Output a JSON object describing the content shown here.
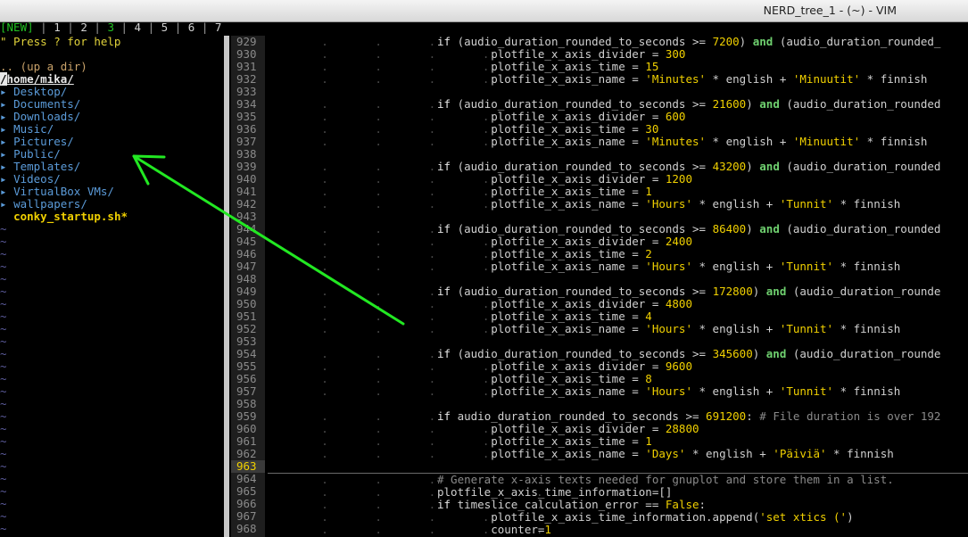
{
  "window": {
    "title": "NERD_tree_1 - (~) - VIM"
  },
  "tabline": {
    "tabs": [
      {
        "label": "[NEW]"
      },
      {
        "label": "1"
      },
      {
        "label": "2"
      },
      {
        "label": "3"
      },
      {
        "label": "4"
      },
      {
        "label": "5"
      },
      {
        "label": "6"
      },
      {
        "label": "7"
      }
    ],
    "active_index": 3
  },
  "tree": {
    "help": "\" Press ? for help",
    "updir": ".. (up a dir)",
    "root_cursor": "/",
    "root_rest": "home/mika/",
    "dirs": [
      "Desktop/",
      "Documents/",
      "Downloads/",
      "Music/",
      "Pictures/",
      "Public/",
      "Templates/",
      "Videos/",
      "VirtualBox VMs/",
      "wallpapers/"
    ],
    "file": "conky_startup.sh*",
    "dir_arrow": "▸",
    "tilde": "~"
  },
  "editor": {
    "current_line": "963",
    "lines": [
      {
        "n": "929",
        "t": "if (audio_duration_rounded_to_seconds >= 7200) and (audio_duration_rounded_"
      },
      {
        "n": "930",
        "t": "        plotfile_x_axis_divider = 300"
      },
      {
        "n": "931",
        "t": "        plotfile_x_axis_time = 15"
      },
      {
        "n": "932",
        "t": "        plotfile_x_axis_name = 'Minutes' * english + 'Minuutit' * finnish"
      },
      {
        "n": "933",
        "t": ""
      },
      {
        "n": "934",
        "t": "if (audio_duration_rounded_to_seconds >= 21600) and (audio_duration_rounded"
      },
      {
        "n": "935",
        "t": "        plotfile_x_axis_divider = 600"
      },
      {
        "n": "936",
        "t": "        plotfile_x_axis_time = 30"
      },
      {
        "n": "937",
        "t": "        plotfile_x_axis_name = 'Minutes' * english + 'Minuutit' * finnish"
      },
      {
        "n": "938",
        "t": ""
      },
      {
        "n": "939",
        "t": "if (audio_duration_rounded_to_seconds >= 43200) and (audio_duration_rounded"
      },
      {
        "n": "940",
        "t": "        plotfile_x_axis_divider = 1200"
      },
      {
        "n": "941",
        "t": "        plotfile_x_axis_time = 1"
      },
      {
        "n": "942",
        "t": "        plotfile_x_axis_name = 'Hours' * english + 'Tunnit' * finnish"
      },
      {
        "n": "943",
        "t": ""
      },
      {
        "n": "944",
        "t": "if (audio_duration_rounded_to_seconds >= 86400) and (audio_duration_rounded"
      },
      {
        "n": "945",
        "t": "        plotfile_x_axis_divider = 2400"
      },
      {
        "n": "946",
        "t": "        plotfile_x_axis_time = 2"
      },
      {
        "n": "947",
        "t": "        plotfile_x_axis_name = 'Hours' * english + 'Tunnit' * finnish"
      },
      {
        "n": "948",
        "t": ""
      },
      {
        "n": "949",
        "t": "if (audio_duration_rounded_to_seconds >= 172800) and (audio_duration_rounde"
      },
      {
        "n": "950",
        "t": "        plotfile_x_axis_divider = 4800"
      },
      {
        "n": "951",
        "t": "        plotfile_x_axis_time = 4"
      },
      {
        "n": "952",
        "t": "        plotfile_x_axis_name = 'Hours' * english + 'Tunnit' * finnish"
      },
      {
        "n": "953",
        "t": ""
      },
      {
        "n": "954",
        "t": "if (audio_duration_rounded_to_seconds >= 345600) and (audio_duration_rounde"
      },
      {
        "n": "955",
        "t": "        plotfile_x_axis_divider = 9600"
      },
      {
        "n": "956",
        "t": "        plotfile_x_axis_time = 8"
      },
      {
        "n": "957",
        "t": "        plotfile_x_axis_name = 'Hours' * english + 'Tunnit' * finnish"
      },
      {
        "n": "958",
        "t": ""
      },
      {
        "n": "959",
        "t": "if audio_duration_rounded_to_seconds >= 691200: # File duration is over 192"
      },
      {
        "n": "960",
        "t": "        plotfile_x_axis_divider = 28800"
      },
      {
        "n": "961",
        "t": "        plotfile_x_axis_time = 1"
      },
      {
        "n": "962",
        "t": "        plotfile_x_axis_name = 'Days' * english + 'Päiviä' * finnish"
      },
      {
        "n": "963",
        "t": ""
      },
      {
        "n": "964",
        "t": "# Generate x-axis texts needed for gnuplot and store them in a list."
      },
      {
        "n": "965",
        "t": "plotfile_x_axis_time_information=[]"
      },
      {
        "n": "966",
        "t": "if timeslice_calculation_error == False:"
      },
      {
        "n": "967",
        "t": "        plotfile_x_axis_time_information.append('set xtics (')"
      },
      {
        "n": "968",
        "t": "        counter=1"
      }
    ]
  },
  "colors": {
    "arrow": "#22e822",
    "dir": "#5b9bd9",
    "file": "#f0d000"
  }
}
